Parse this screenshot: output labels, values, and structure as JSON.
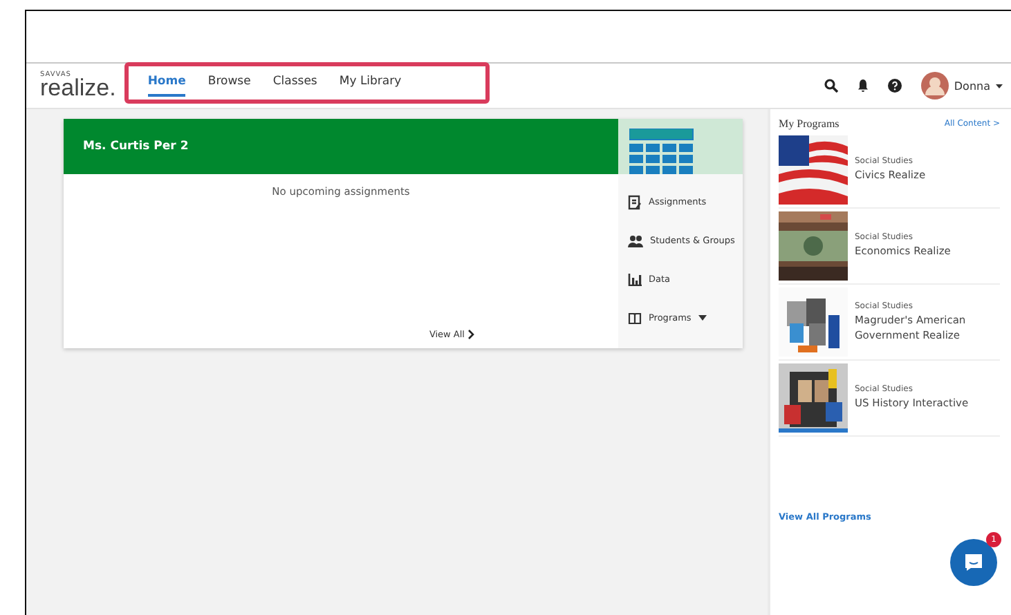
{
  "header": {
    "logo": {
      "brand": "SAVVAS",
      "product": "realize."
    },
    "nav": [
      {
        "label": "Home",
        "selected": true
      },
      {
        "label": "Browse",
        "selected": false
      },
      {
        "label": "Classes",
        "selected": false
      },
      {
        "label": "My Library",
        "selected": false
      }
    ],
    "user": {
      "name": "Donna"
    }
  },
  "class_card": {
    "title": "Ms. Curtis Per 2",
    "empty_message": "No upcoming assignments",
    "view_all": "View All",
    "links": [
      {
        "kind": "assignments",
        "label": "Assignments"
      },
      {
        "kind": "students",
        "label": "Students & Groups"
      },
      {
        "kind": "data",
        "label": "Data"
      },
      {
        "kind": "programs",
        "label": "Programs"
      }
    ]
  },
  "programs_panel": {
    "title": "My Programs",
    "all_content": "All Content >",
    "programs": [
      {
        "subject": "Social Studies",
        "name": "Civics Realize"
      },
      {
        "subject": "Social Studies",
        "name": "Economics Realize"
      },
      {
        "subject": "Social Studies",
        "name": "Magruder's American Government Realize"
      },
      {
        "subject": "Social Studies",
        "name": "US History Interactive"
      }
    ],
    "view_all": "View All Programs"
  },
  "chat": {
    "badge": "1"
  }
}
